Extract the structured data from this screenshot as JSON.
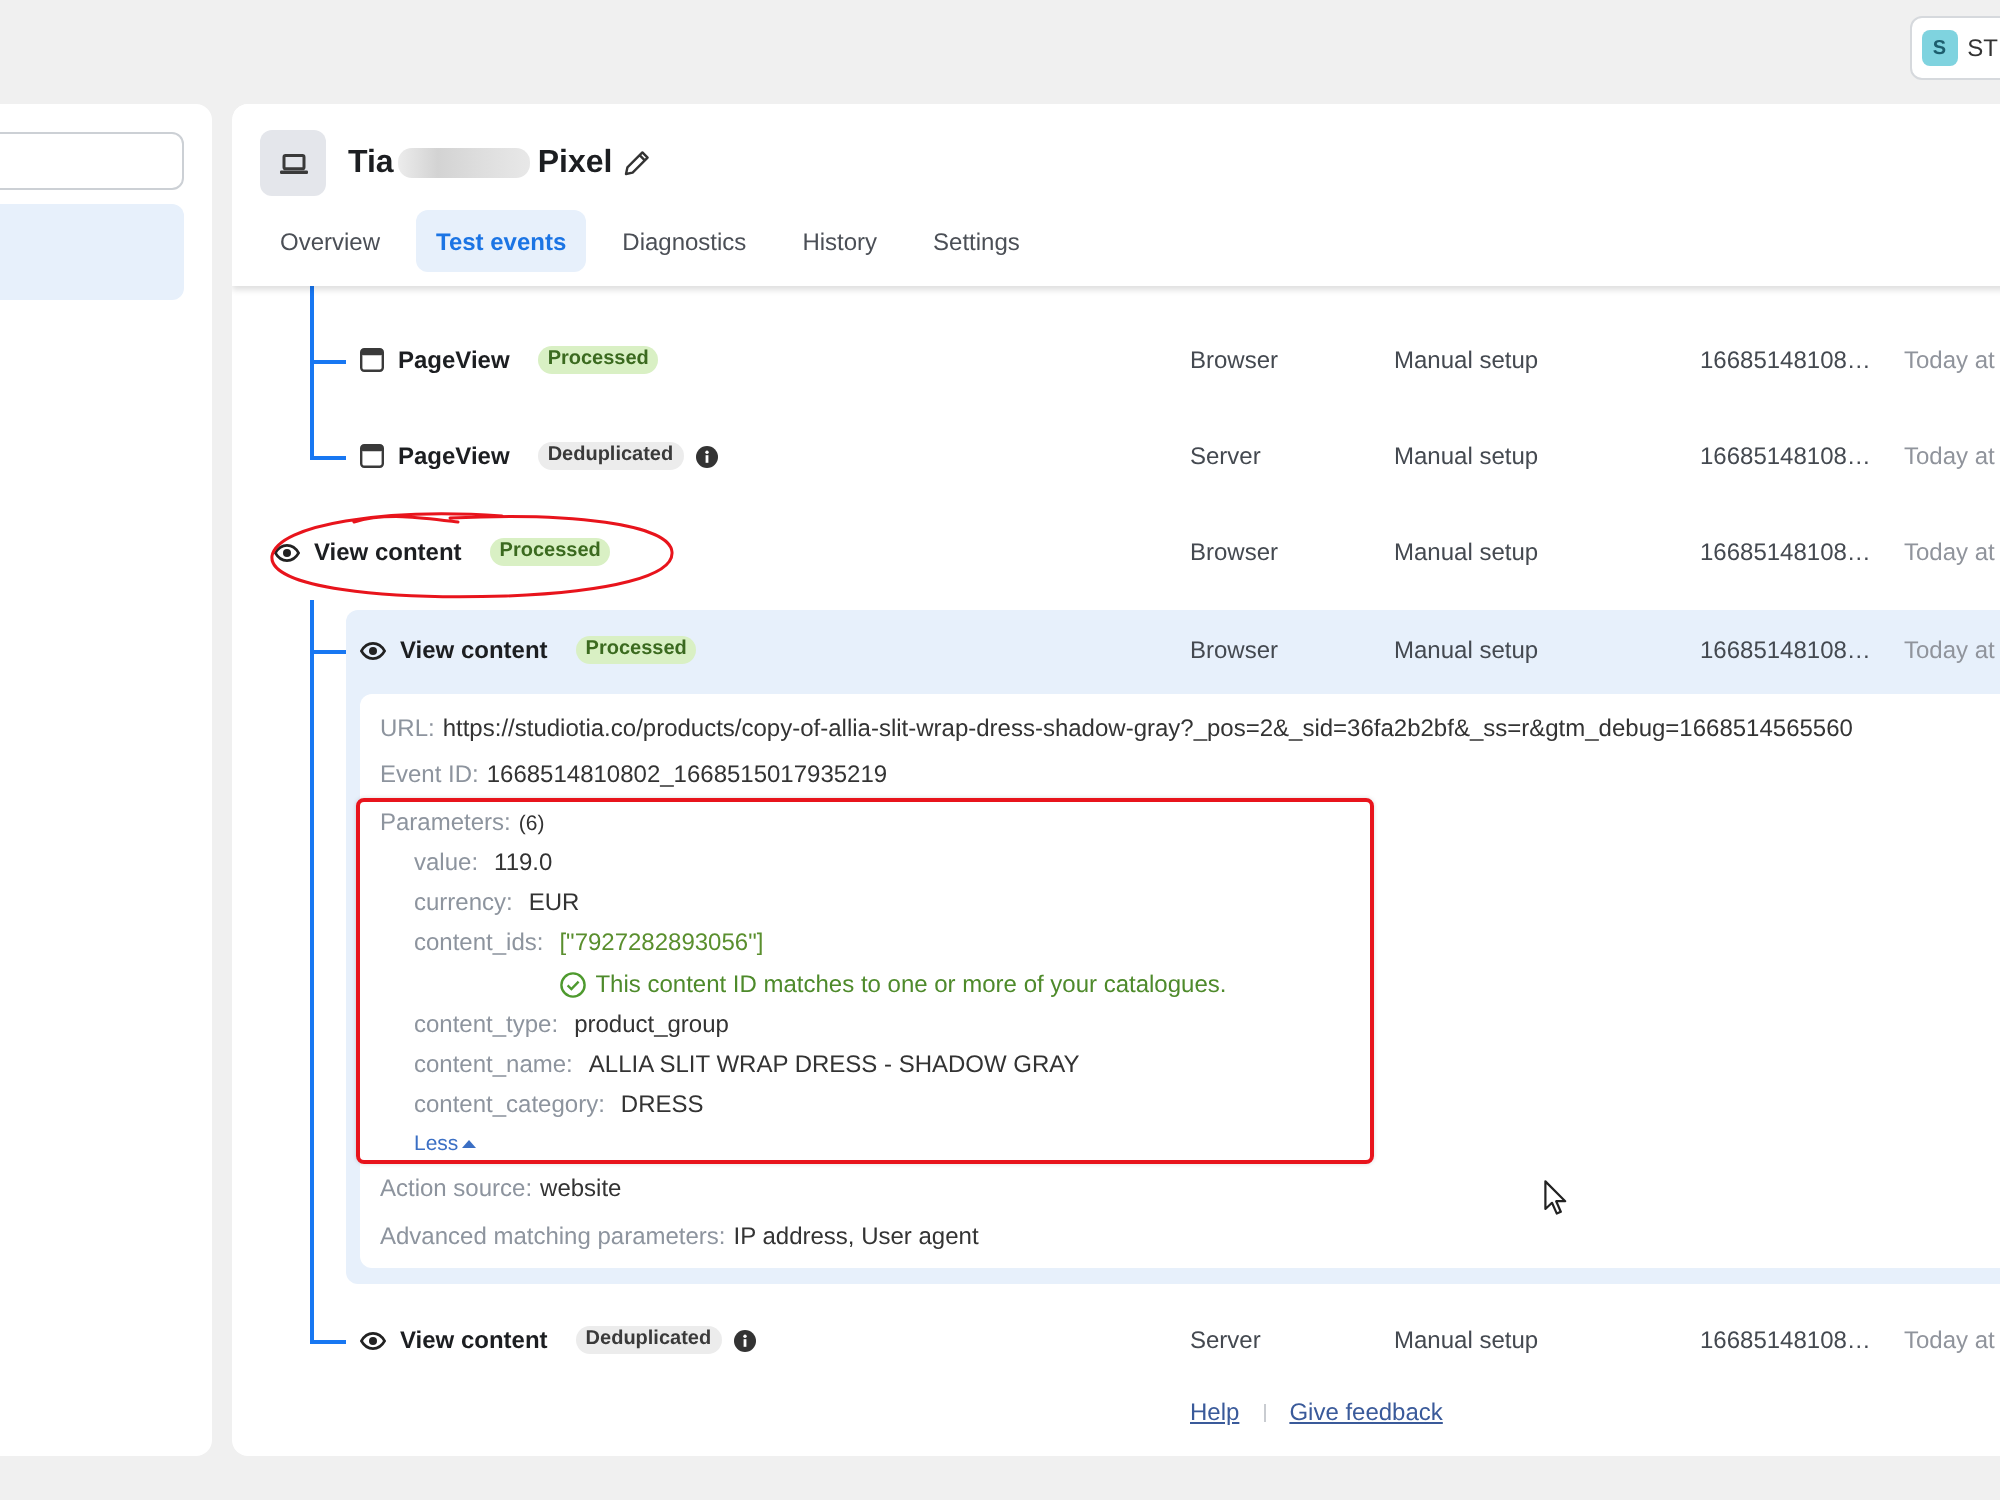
{
  "account": {
    "initial": "S",
    "name": "ST"
  },
  "sidebar": {
    "items": [
      {
        "selected": true
      }
    ]
  },
  "pixel": {
    "title_start": "Tia",
    "title_end": "Pixel",
    "redacted": true
  },
  "tabs": [
    {
      "label": "Overview",
      "selected": false
    },
    {
      "label": "Test events",
      "selected": true
    },
    {
      "label": "Diagnostics",
      "selected": false
    },
    {
      "label": "History",
      "selected": false
    },
    {
      "label": "Settings",
      "selected": false
    }
  ],
  "events": [
    {
      "children": [
        {
          "kind": "pageview",
          "name": "PageView",
          "status": {
            "kind": "processed",
            "label": "Processed"
          },
          "cells": [
            "Browser",
            "Manual setup",
            "16685148108…",
            "Today at"
          ],
          "expanded": false,
          "circled": false
        },
        {
          "kind": "pageview",
          "name": "PageView",
          "status": {
            "kind": "deduplicated",
            "label": "Deduplicated"
          },
          "cells": [
            "Server",
            "Manual setup",
            "16685148108…",
            "Today at"
          ],
          "expanded": false,
          "circled": false
        }
      ]
    },
    {
      "kind": "viewcontent",
      "name": "View content",
      "status": {
        "kind": "processed",
        "label": "Processed"
      },
      "cells": [
        "Browser",
        "Manual setup",
        "16685148108…",
        "Today at"
      ],
      "expanded": false,
      "circled": true,
      "children": [
        {
          "kind": "viewcontent",
          "name": "View content",
          "status": {
            "kind": "processed",
            "label": "Processed"
          },
          "cells": [
            "Browser",
            "Manual setup",
            "16685148108…",
            "Today at"
          ],
          "expanded": true,
          "circled": false,
          "details": {
            "fields": [
              {
                "label": "URL:",
                "value": "https://studiotia.co/products/copy-of-allia-slit-wrap-dress-shadow-gray?_pos=2&_sid=36fa2b2bf&_ss=r&gtm_debug=1668514565560"
              },
              {
                "label": "Event ID:",
                "value": "1668514810802_1668515017935219"
              }
            ],
            "parameters": {
              "label": "Parameters:",
              "count": "(6)",
              "highlighted": true,
              "items": [
                {
                  "kind": "plain",
                  "key": "value:",
                  "value": "119.0"
                },
                {
                  "kind": "plain",
                  "key": "currency:",
                  "value": "EUR"
                },
                {
                  "kind": "matched",
                  "key": "content_ids:",
                  "value": "[\"7927282893056\"]",
                  "note": "This content ID matches to one or more of your catalogues."
                },
                {
                  "kind": "plain",
                  "key": "content_type:",
                  "value": "product_group"
                },
                {
                  "kind": "plain",
                  "key": "content_name:",
                  "value": "ALLIA SLIT WRAP DRESS - SHADOW GRAY"
                },
                {
                  "kind": "plain",
                  "key": "content_category:",
                  "value": "DRESS"
                }
              ],
              "toggle": "Less"
            },
            "extra_fields": [
              {
                "label": "Action source:",
                "value": "website"
              },
              {
                "label": "Advanced matching parameters:",
                "value": "IP address, User agent"
              }
            ]
          }
        },
        {
          "kind": "viewcontent",
          "name": "View content",
          "status": {
            "kind": "deduplicated",
            "label": "Deduplicated"
          },
          "cells": [
            "Server",
            "Manual setup",
            "16685148108…",
            "Today at"
          ],
          "expanded": false,
          "circled": false
        }
      ]
    }
  ],
  "footer": {
    "links": [
      "Help",
      "Give feedback"
    ]
  }
}
